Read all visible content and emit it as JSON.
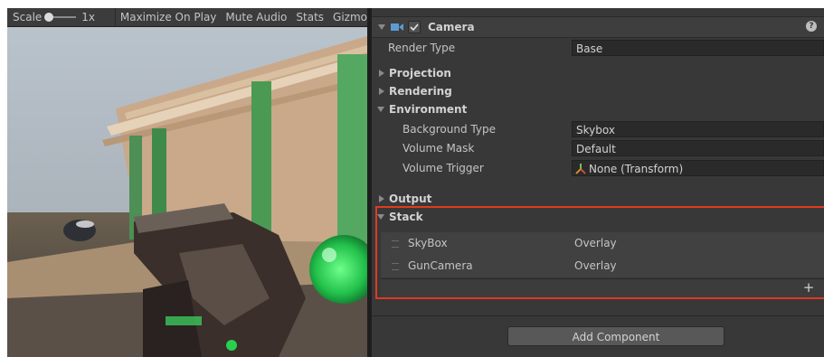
{
  "game_toolbar": {
    "scale_label": "Scale",
    "scale_value": "1x",
    "maximize_on_play": "Maximize On Play",
    "mute_audio": "Mute Audio",
    "stats": "Stats",
    "gizmos": "Gizmo"
  },
  "inspector": {
    "component_title": "Camera",
    "help_glyph": "?",
    "render_type_label": "Render Type",
    "render_type_value": "Base",
    "sections": {
      "projection": "Projection",
      "rendering": "Rendering",
      "environment": "Environment",
      "output": "Output",
      "stack": "Stack"
    },
    "environment": {
      "background_type_label": "Background Type",
      "background_type_value": "Skybox",
      "volume_mask_label": "Volume Mask",
      "volume_mask_value": "Default",
      "volume_trigger_label": "Volume Trigger",
      "volume_trigger_value": "None (Transform)"
    },
    "stack_items": [
      {
        "name": "SkyBox",
        "type": "Overlay"
      },
      {
        "name": "GunCamera",
        "type": "Overlay"
      }
    ],
    "add_component": "Add Component",
    "plus_glyph": "+"
  },
  "colors": {
    "highlight": "#dd3b1f",
    "camera_icon": "#5b9bd5",
    "panel_bg": "#383838"
  },
  "icons": [
    "camera-icon",
    "checkbox-checked-icon",
    "help-icon",
    "transform-icon",
    "plus-icon",
    "drag-handle-icon"
  ]
}
